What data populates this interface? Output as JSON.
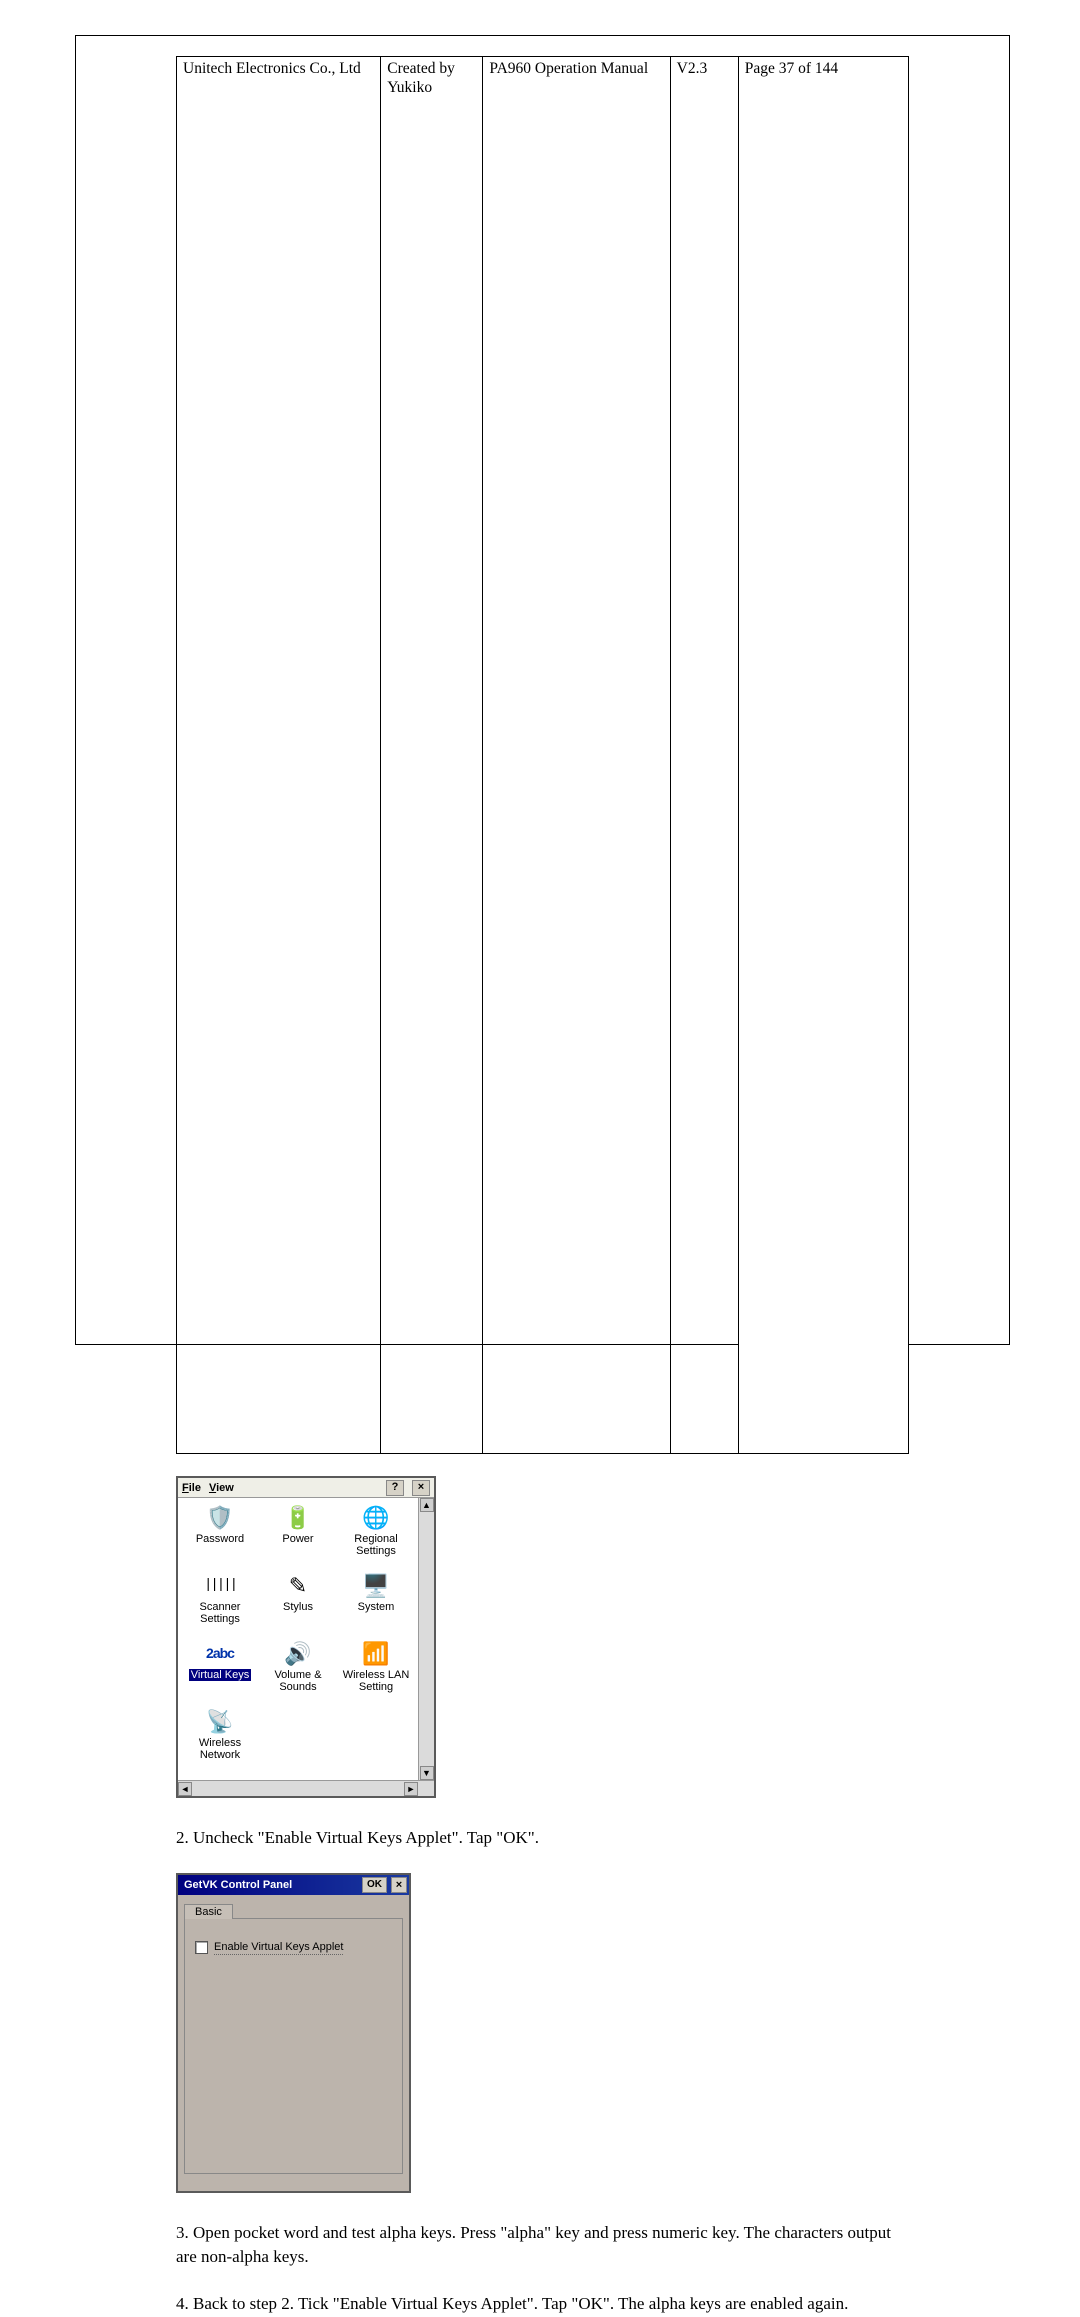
{
  "header": {
    "company": "Unitech Electronics Co., Ltd",
    "created": "Created by Yukiko",
    "docname": "PA960 Operation Manual",
    "version": "V2.3",
    "page": "Page 37 of 144"
  },
  "control_panel": {
    "menu_file": "File",
    "menu_view": "View",
    "help_btn": "?",
    "close_btn": "×",
    "up_arrow": "▲",
    "down_arrow": "▼",
    "left_arrow": "◄",
    "right_arrow": "►",
    "items": [
      {
        "label": "Password",
        "icon": "password-icon",
        "glyph": "🛡️"
      },
      {
        "label": "Power",
        "icon": "power-icon",
        "glyph": "🔋"
      },
      {
        "label": "Regional Settings",
        "icon": "regional-settings-icon",
        "glyph": "🌐"
      },
      {
        "label": "Scanner Settings",
        "icon": "scanner-settings-icon",
        "glyph": "|||||"
      },
      {
        "label": "Stylus",
        "icon": "stylus-icon",
        "glyph": "✎"
      },
      {
        "label": "System",
        "icon": "system-icon",
        "glyph": "🖥️"
      },
      {
        "label": "Virtual Keys",
        "icon": "virtual-keys-icon",
        "glyph": "2abc",
        "selected": true
      },
      {
        "label": "Volume & Sounds",
        "icon": "volume-sounds-icon",
        "glyph": "🔊"
      },
      {
        "label": "Wireless LAN Setting",
        "icon": "wireless-lan-icon",
        "glyph": "📶"
      },
      {
        "label": "Wireless Network",
        "icon": "wireless-network-icon",
        "glyph": "📡"
      }
    ]
  },
  "step2_text": "2. Uncheck \"Enable Virtual Keys Applet\". Tap \"OK\".",
  "getvk": {
    "title": "GetVK Control Panel",
    "ok_label": "OK",
    "close_label": "×",
    "tab_label": "Basic",
    "checkbox_label": "Enable Virtual Keys Applet"
  },
  "step3_text": "3. Open pocket word and test alpha keys. Press \"alpha\" key and press numeric key. The characters output are non-alpha keys.",
  "step4_text": "4. Back to step 2. Tick \"Enable Virtual Keys Applet\". Tap \"OK\". The alpha keys are enabled again."
}
